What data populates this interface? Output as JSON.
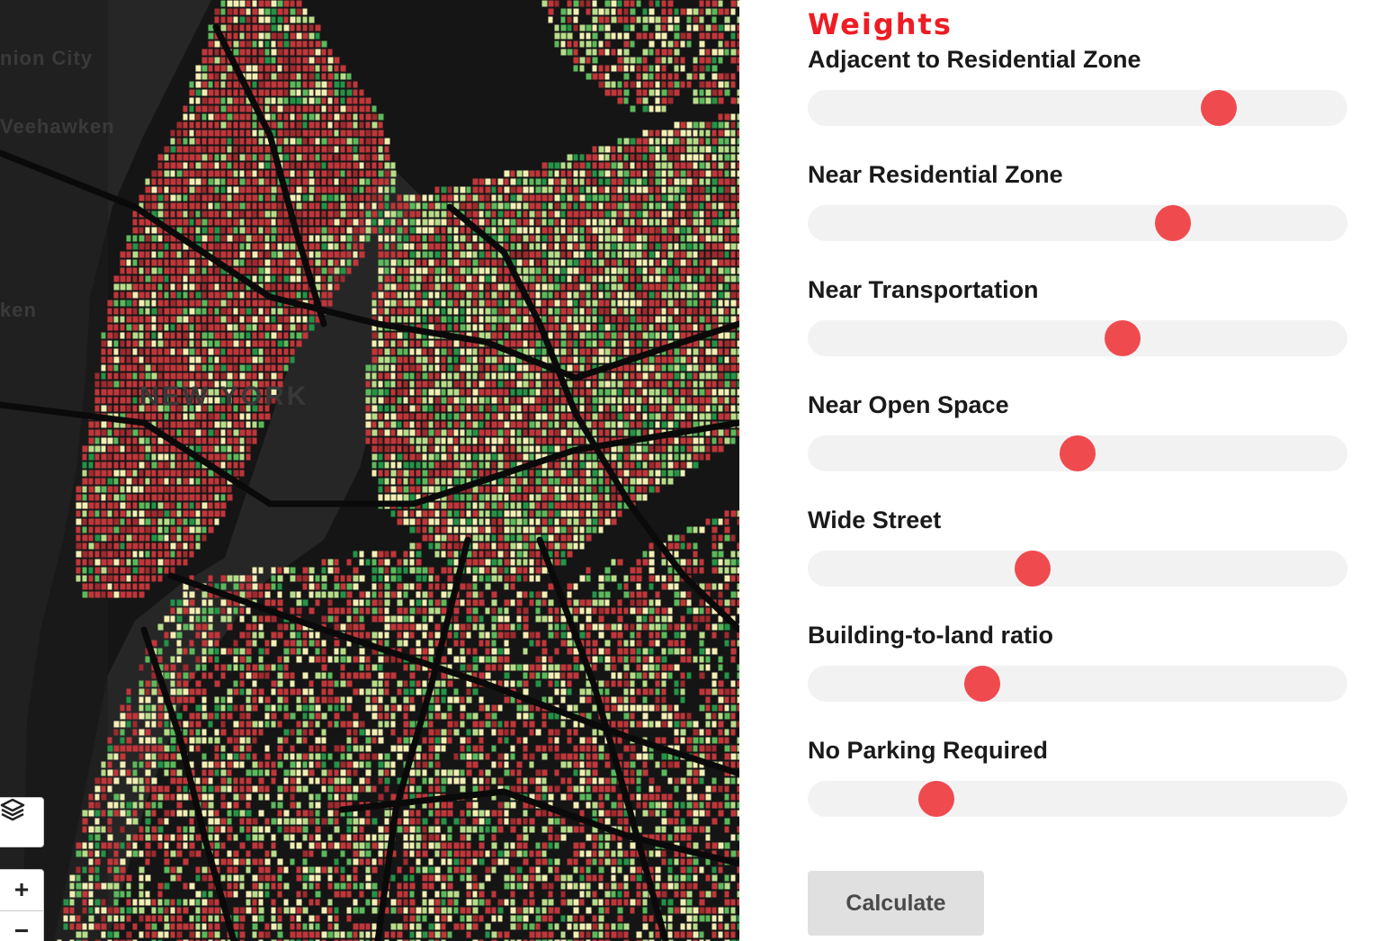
{
  "map": {
    "labels": {
      "union_city": "nion City",
      "weehawken": "Veehawken",
      "hoboken": "ken",
      "new_york": "NEW YORK"
    },
    "colors": {
      "background": "#151515",
      "water": "#2b2b2b",
      "street": "#2a2a2a",
      "lot_red": "#c0363a",
      "lot_dark_red": "#9c2a2e",
      "lot_cream": "#f2eeb5",
      "lot_light_green": "#b7dc8a",
      "lot_green": "#5cb85c",
      "lot_dark_green": "#249348"
    },
    "controls": {
      "layers_icon": "layers-icon",
      "zoom_in": "+",
      "zoom_out": "−"
    }
  },
  "panel": {
    "title": "Weights",
    "accent_color": "#ee1c24",
    "thumb_color": "#ef4b4f",
    "sliders": [
      {
        "label": "Adjacent to Residential Zone",
        "value": 0.78
      },
      {
        "label": "Near Residential Zone",
        "value": 0.69
      },
      {
        "label": "Near Transportation",
        "value": 0.59
      },
      {
        "label": "Near Open Space",
        "value": 0.5
      },
      {
        "label": "Wide Street",
        "value": 0.41
      },
      {
        "label": "Building-to-land ratio",
        "value": 0.31
      },
      {
        "label": "No Parking Required",
        "value": 0.22
      }
    ],
    "calculate_label": "Calculate"
  }
}
